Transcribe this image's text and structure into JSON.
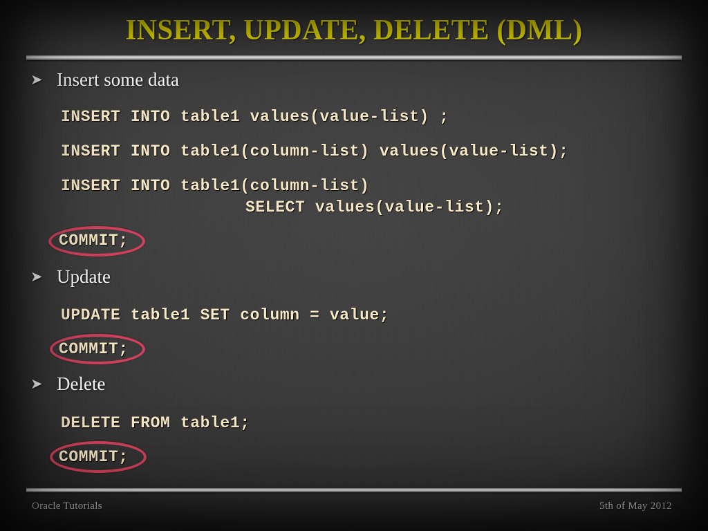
{
  "slide": {
    "title": "INSERT, UPDATE, DELETE (DML)",
    "title_color": "#f5ea00",
    "background_color": "#3a3a3a",
    "code_color": "#f7e8c6",
    "highlight_color": "#d9415e",
    "bullet_glyph": "➤"
  },
  "sections": [
    {
      "bullet": "Insert some data",
      "code_lines": [
        "INSERT INTO table1 values(value-list) ;",
        "INSERT INTO table1(column-list) values(value-list);",
        "INSERT INTO table1(column-list)",
        "SELECT values(value-list);"
      ],
      "commit": "COMMIT;"
    },
    {
      "bullet": "Update",
      "code_lines": [
        "UPDATE table1 SET column = value;"
      ],
      "commit": "COMMIT;"
    },
    {
      "bullet": "Delete",
      "code_lines": [
        "DELETE FROM table1;"
      ],
      "commit": "COMMIT;"
    }
  ],
  "footer": {
    "left": "Oracle Tutorials",
    "right": "5th of May 2012"
  }
}
